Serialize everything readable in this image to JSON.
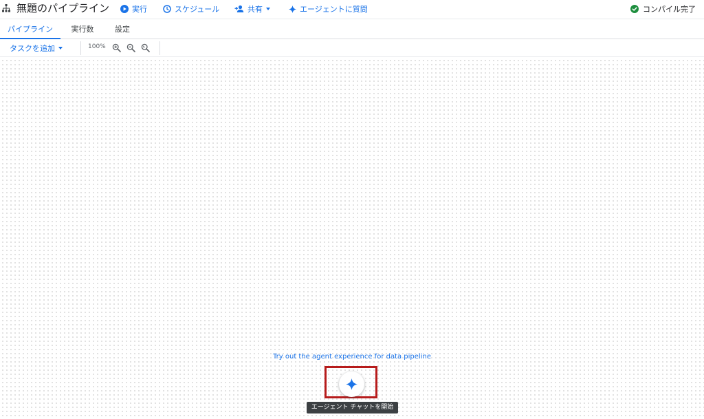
{
  "header": {
    "title": "無題のパイプライン",
    "actions": {
      "run": "実行",
      "schedule": "スケジュール",
      "share": "共有",
      "ask_agent": "エージェントに質問"
    },
    "compile_status": "コンパイル完了",
    "compile_status_color": "#1e8e3e"
  },
  "tabs": [
    {
      "label": "パイプライン",
      "active": true
    },
    {
      "label": "実行数",
      "active": false
    },
    {
      "label": "設定",
      "active": false
    }
  ],
  "toolbar": {
    "add_task": "タスクを追加",
    "zoom_level": "100%",
    "icons": [
      "zoom-in-icon",
      "zoom-out-icon",
      "zoom-reset-icon"
    ]
  },
  "canvas": {
    "agent_prompt": "Try out the agent experience for data pipeline",
    "agent_button_icon": "sparkle-icon",
    "tooltip": "エージェント チャットを開始"
  },
  "colors": {
    "accent": "#1a73e8",
    "highlight": "#b71c1c"
  }
}
